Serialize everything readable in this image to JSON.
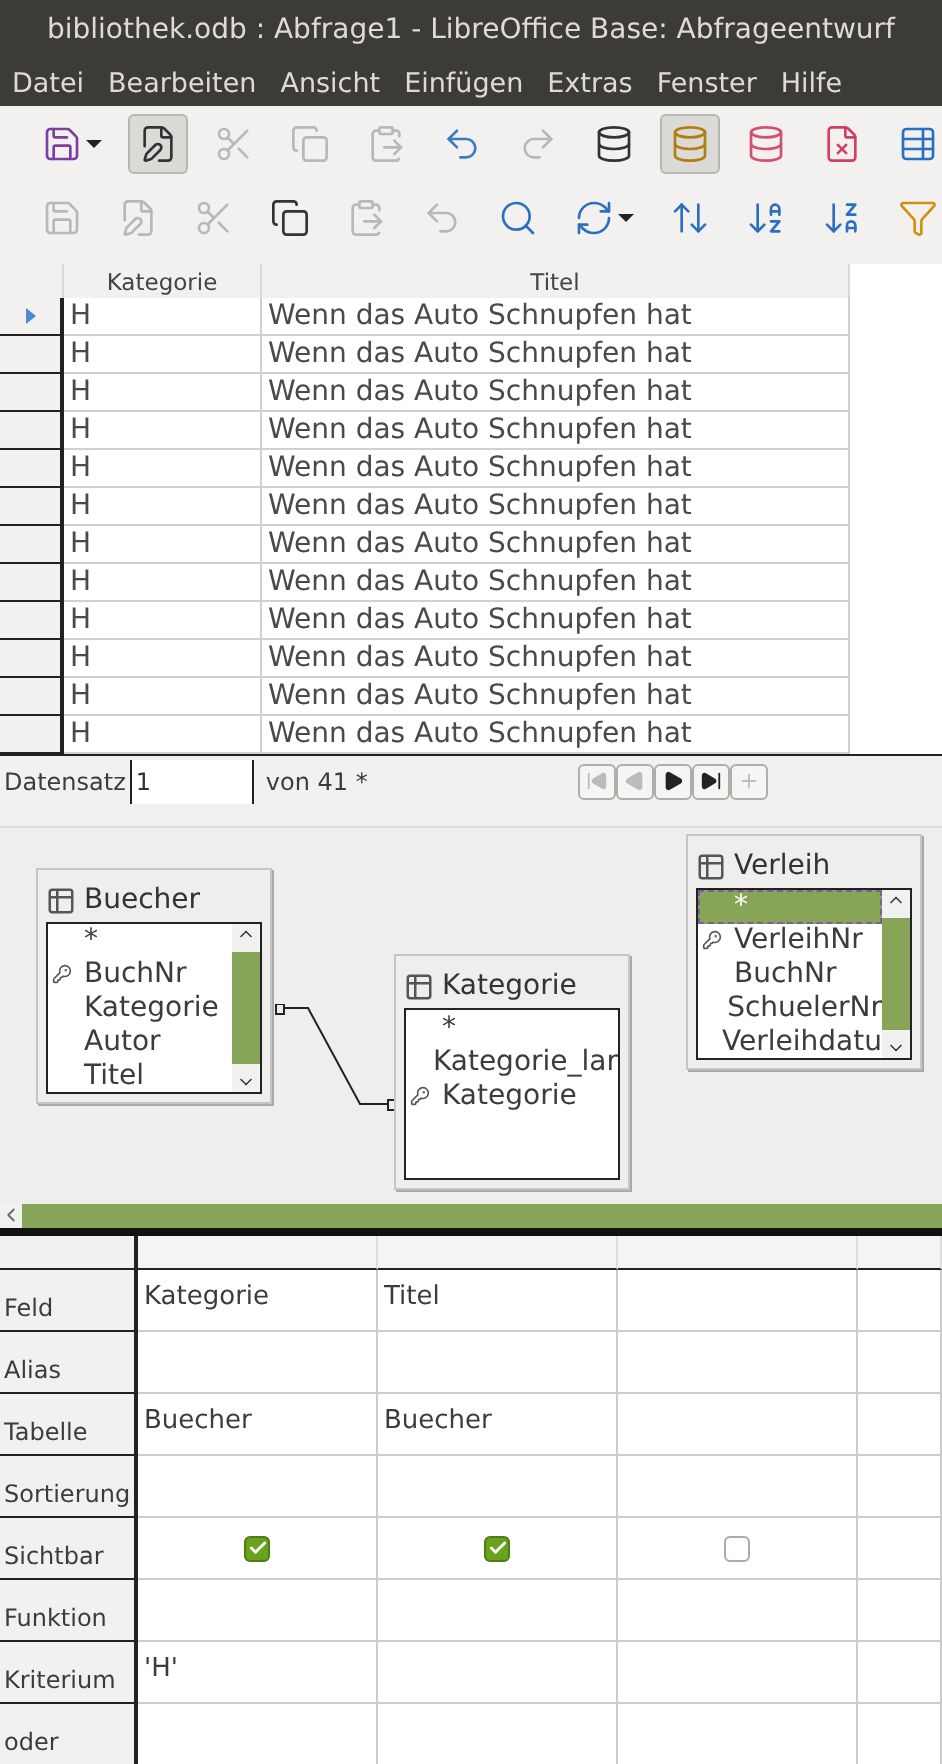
{
  "window": {
    "title": "bibliothek.odb : Abfrage1 - LibreOffice Base: Abfrageentwurf"
  },
  "menu": [
    "Datei",
    "Bearbeiten",
    "Ansicht",
    "Einfügen",
    "Extras",
    "Fenster",
    "Hilfe"
  ],
  "toolbars": [
    [
      {
        "kind": "save",
        "disabled": false,
        "pressed": false,
        "dropdown": true
      },
      {
        "kind": "edit",
        "disabled": false,
        "pressed": true,
        "dropdown": false
      },
      {
        "kind": "cut",
        "disabled": true,
        "pressed": false,
        "dropdown": false
      },
      {
        "kind": "copy",
        "disabled": true,
        "pressed": false,
        "dropdown": false
      },
      {
        "kind": "paste",
        "disabled": true,
        "pressed": false,
        "dropdown": false
      },
      {
        "kind": "undo",
        "disabled": false,
        "pressed": false,
        "dropdown": false
      },
      {
        "kind": "redo",
        "disabled": true,
        "pressed": false,
        "dropdown": false
      },
      {
        "kind": "run",
        "disabled": false,
        "pressed": false,
        "dropdown": false
      },
      {
        "kind": "design",
        "disabled": false,
        "pressed": true,
        "dropdown": false
      },
      {
        "kind": "clear",
        "disabled": false,
        "pressed": false,
        "dropdown": false
      },
      {
        "kind": "close",
        "disabled": false,
        "pressed": false,
        "dropdown": false
      },
      {
        "kind": "addtable",
        "disabled": false,
        "pressed": false,
        "dropdown": false
      }
    ],
    [
      {
        "kind": "save",
        "disabled": true,
        "pressed": false,
        "dropdown": false
      },
      {
        "kind": "edit",
        "disabled": true,
        "pressed": false,
        "dropdown": false
      },
      {
        "kind": "cut",
        "disabled": true,
        "pressed": false,
        "dropdown": false
      },
      {
        "kind": "copy",
        "disabled": false,
        "pressed": false,
        "dropdown": false
      },
      {
        "kind": "paste",
        "disabled": true,
        "pressed": false,
        "dropdown": false
      },
      {
        "kind": "undo",
        "disabled": true,
        "pressed": false,
        "dropdown": false
      },
      {
        "kind": "search",
        "disabled": false,
        "pressed": false,
        "dropdown": false
      },
      {
        "kind": "refresh",
        "disabled": false,
        "pressed": false,
        "dropdown": true
      },
      {
        "kind": "sort",
        "disabled": false,
        "pressed": false,
        "dropdown": false
      },
      {
        "kind": "sortasc",
        "disabled": false,
        "pressed": false,
        "dropdown": false
      },
      {
        "kind": "sortdesc",
        "disabled": false,
        "pressed": false,
        "dropdown": false
      },
      {
        "kind": "filter",
        "disabled": false,
        "pressed": false,
        "dropdown": false
      }
    ]
  ],
  "results": {
    "columns": [
      "Kategorie",
      "Titel"
    ],
    "rows": [
      {
        "current": true,
        "cells": [
          "H",
          "Wenn das Auto Schnupfen hat"
        ]
      },
      {
        "current": false,
        "cells": [
          "H",
          "Wenn das Auto Schnupfen hat"
        ]
      },
      {
        "current": false,
        "cells": [
          "H",
          "Wenn das Auto Schnupfen hat"
        ]
      },
      {
        "current": false,
        "cells": [
          "H",
          "Wenn das Auto Schnupfen hat"
        ]
      },
      {
        "current": false,
        "cells": [
          "H",
          "Wenn das Auto Schnupfen hat"
        ]
      },
      {
        "current": false,
        "cells": [
          "H",
          "Wenn das Auto Schnupfen hat"
        ]
      },
      {
        "current": false,
        "cells": [
          "H",
          "Wenn das Auto Schnupfen hat"
        ]
      },
      {
        "current": false,
        "cells": [
          "H",
          "Wenn das Auto Schnupfen hat"
        ]
      },
      {
        "current": false,
        "cells": [
          "H",
          "Wenn das Auto Schnupfen hat"
        ]
      },
      {
        "current": false,
        "cells": [
          "H",
          "Wenn das Auto Schnupfen hat"
        ]
      },
      {
        "current": false,
        "cells": [
          "H",
          "Wenn das Auto Schnupfen hat"
        ]
      },
      {
        "current": false,
        "cells": [
          "H",
          "Wenn das Auto Schnupfen hat"
        ]
      }
    ]
  },
  "navigation": {
    "label": "Datensatz",
    "value": "1",
    "count": "von  41 *",
    "buttons": [
      {
        "kind": "first",
        "disabled": true
      },
      {
        "kind": "prev",
        "disabled": true
      },
      {
        "kind": "next",
        "disabled": false
      },
      {
        "kind": "last",
        "disabled": false
      },
      {
        "kind": "new",
        "disabled": true
      }
    ]
  },
  "tables": [
    {
      "name": "Buecher",
      "fields": [
        {
          "name": "*",
          "key": false,
          "selected": false
        },
        {
          "name": "BuchNr",
          "key": true,
          "selected": false
        },
        {
          "name": "Kategorie",
          "key": false,
          "selected": false
        },
        {
          "name": "Autor",
          "key": false,
          "selected": false
        },
        {
          "name": "Titel",
          "key": false,
          "selected": false
        }
      ]
    },
    {
      "name": "Kategorie",
      "fields": [
        {
          "name": "*",
          "key": false,
          "selected": false
        },
        {
          "name": "Kategorie_lar",
          "key": false,
          "selected": false
        },
        {
          "name": "Kategorie",
          "key": true,
          "selected": false
        }
      ]
    },
    {
      "name": "Verleih",
      "fields": [
        {
          "name": "*",
          "key": false,
          "selected": true
        },
        {
          "name": "VerleihNr",
          "key": true,
          "selected": false
        },
        {
          "name": "BuchNr",
          "key": false,
          "selected": false
        },
        {
          "name": "SchuelerNr",
          "key": false,
          "selected": false
        },
        {
          "name": "Verleihdatu",
          "key": false,
          "selected": false
        }
      ]
    }
  ],
  "query": {
    "row_labels": [
      {
        "label": "Feld",
        "kind": "field"
      },
      {
        "label": "Alias",
        "kind": "alias"
      },
      {
        "label": "Tabelle",
        "kind": "table"
      },
      {
        "label": "Sortierung",
        "kind": "sort"
      },
      {
        "label": "Sichtbar",
        "kind": "visible"
      },
      {
        "label": "Funktion",
        "kind": "function"
      },
      {
        "label": "Kriterium",
        "kind": "criterion"
      },
      {
        "label": "oder",
        "kind": "or"
      }
    ],
    "columns": [
      {
        "field": "Kategorie",
        "table": "Buecher",
        "visible": true,
        "criterion": "'H'"
      },
      {
        "field": "Titel",
        "table": "Buecher",
        "visible": true
      },
      {
        "visible": false
      }
    ]
  }
}
